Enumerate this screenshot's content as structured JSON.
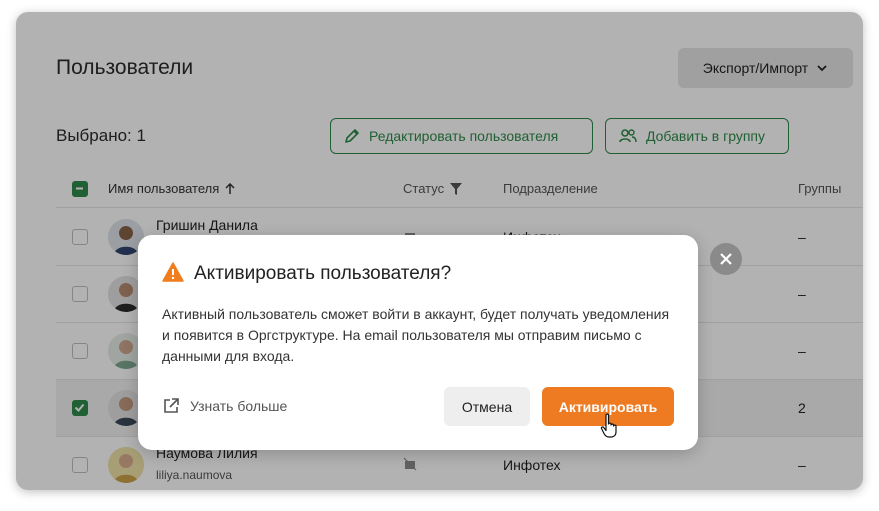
{
  "header": {
    "title": "Пользователи",
    "export_label": "Экспорт/Импорт"
  },
  "toolbar": {
    "selected_label": "Выбрано: 1",
    "edit_label": "Редактировать пользователя",
    "add_group_label": "Добавить в группу"
  },
  "table": {
    "columns": {
      "name": "Имя пользователя",
      "status": "Статус",
      "dept": "Подразделение",
      "groups": "Группы"
    },
    "rows": [
      {
        "name": "Гришин Данила",
        "login": "",
        "dept": "Инфотех",
        "groups": "–",
        "checked": false
      },
      {
        "name": "",
        "login": "",
        "dept": "",
        "groups": "–",
        "checked": false
      },
      {
        "name": "",
        "login": "",
        "dept": "",
        "groups": "–",
        "checked": false
      },
      {
        "name": "",
        "login": "",
        "dept": "",
        "groups": "2",
        "checked": true
      },
      {
        "name": "Наумова Лилия",
        "login": "liliya.naumova",
        "dept": "Инфотех",
        "groups": "–",
        "checked": false
      }
    ]
  },
  "modal": {
    "title": "Активировать пользователя?",
    "body": "Активный пользователь сможет войти в аккаунт, будет получать уведомления и появится в Оргструктуре. На email пользователя мы отправим письмо с данными для входа.",
    "learn_more": "Узнать больше",
    "cancel_label": "Отмена",
    "activate_label": "Активировать"
  },
  "colors": {
    "accent_green": "#2f8a4b",
    "accent_orange": "#ee7a22",
    "warning_orange": "#f07d1e"
  }
}
